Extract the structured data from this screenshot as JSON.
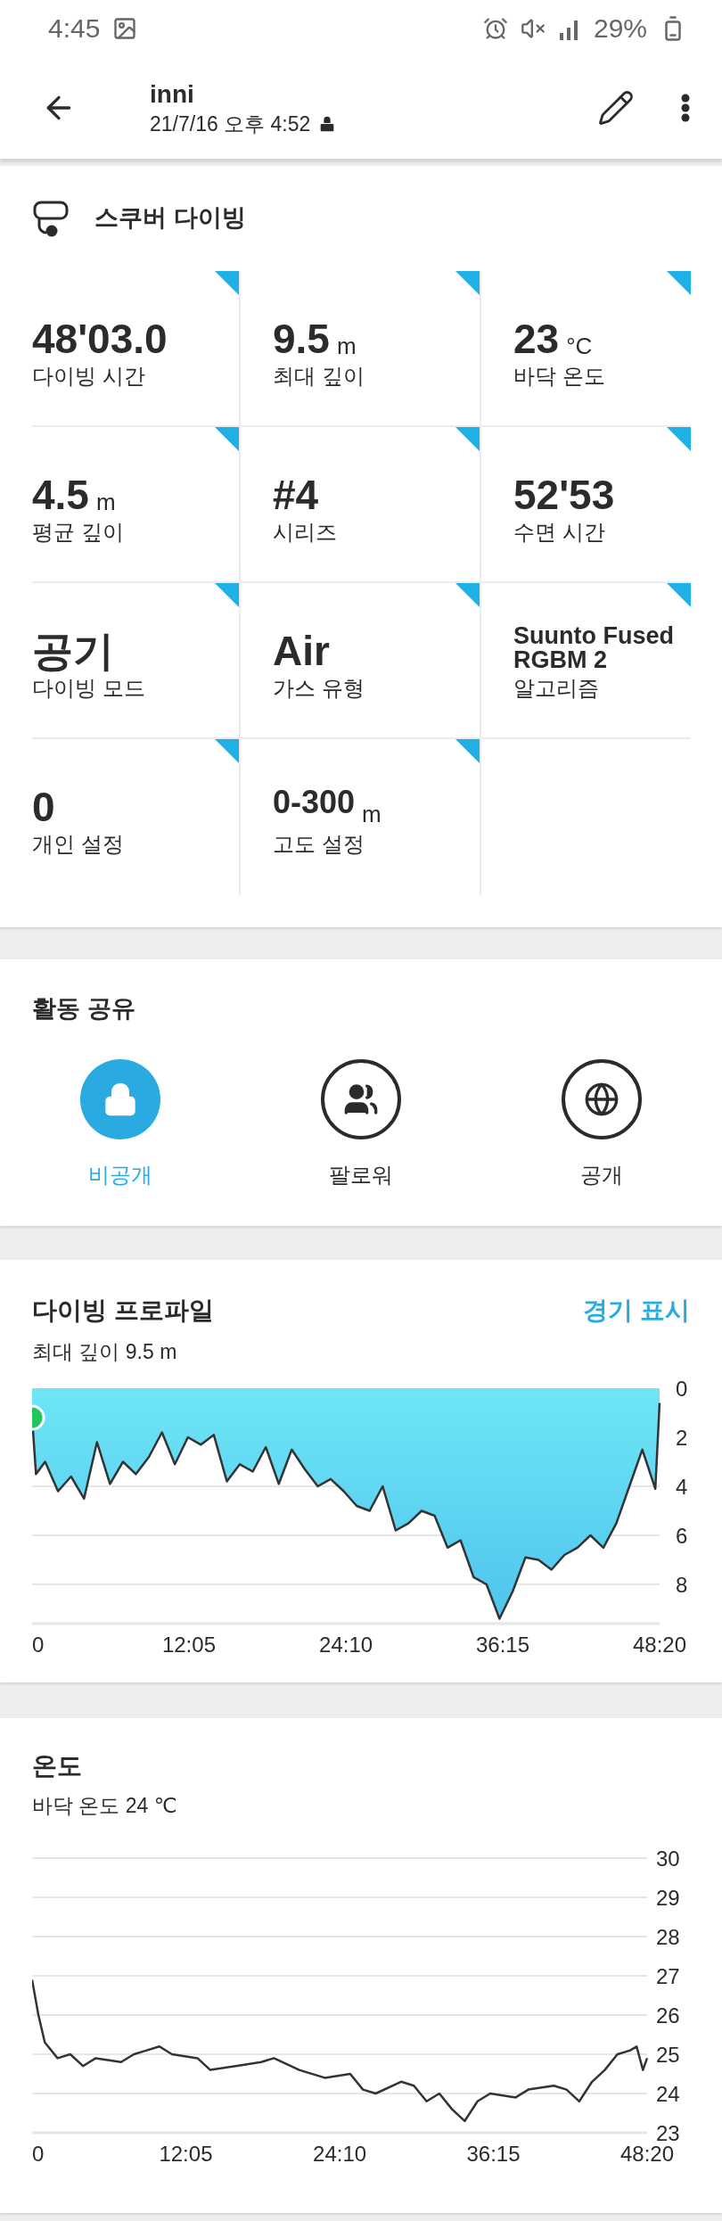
{
  "status_bar": {
    "time": "4:45",
    "battery": "29%"
  },
  "header": {
    "title": "inni",
    "date": "21/7/16 오후 4:52"
  },
  "activity": {
    "title": "스쿠버 다이빙",
    "metrics": [
      {
        "kind": "number",
        "value": "48'03.0",
        "label": "다이빙 시간"
      },
      {
        "kind": "number",
        "value": "9.5",
        "unit": "m",
        "label": "최대 깊이"
      },
      {
        "kind": "number",
        "value": "23",
        "unit": "°C",
        "label": "바닥 온도"
      },
      {
        "kind": "number",
        "value": "4.5",
        "unit": "m",
        "label": "평균 깊이"
      },
      {
        "kind": "number",
        "value": "#4",
        "label": "시리즈"
      },
      {
        "kind": "number",
        "value": "52'53",
        "label": "수면 시간"
      },
      {
        "kind": "number",
        "value": "공기",
        "label": "다이빙 모드"
      },
      {
        "kind": "number",
        "value": "Air",
        "label": "가스 유형"
      },
      {
        "kind": "text",
        "value": "Suunto Fused RGBM 2",
        "label": "알고리즘"
      },
      {
        "kind": "number",
        "value": "0",
        "label": "개인 설정"
      },
      {
        "kind": "small",
        "value": "0-300",
        "unit": "m",
        "label": "고도 설정"
      }
    ]
  },
  "sharing": {
    "title": "활동 공유",
    "options": [
      {
        "kind": "lock",
        "label": "비공개",
        "selected": true
      },
      {
        "kind": "people",
        "label": "팔로워",
        "selected": false
      },
      {
        "kind": "globe",
        "label": "공개",
        "selected": false
      }
    ]
  },
  "profile": {
    "title": "다이빙 프로파일",
    "link": "경기 표시",
    "subtitle": "최대 깊이 9.5 m",
    "chart_data": {
      "type": "area",
      "grid": true,
      "xlim": [
        0,
        48.33
      ],
      "ylim": [
        9.6,
        0
      ],
      "x": [
        0,
        0.3,
        1,
        2,
        3,
        4,
        5,
        6,
        7,
        8,
        9,
        10,
        11,
        12,
        13,
        14,
        15,
        16,
        17,
        18,
        19,
        20,
        21,
        22,
        23,
        24,
        25,
        26,
        27,
        28,
        29,
        30,
        31,
        32,
        33,
        34,
        35,
        36,
        37,
        38,
        39,
        40,
        41,
        42,
        43,
        44,
        45,
        46,
        47,
        48,
        48.33
      ],
      "series": [
        {
          "color": "#333333",
          "values": [
            1.2,
            3.5,
            3.0,
            4.2,
            3.6,
            4.5,
            2.2,
            3.9,
            3.0,
            3.5,
            2.8,
            1.8,
            3.1,
            2.0,
            2.3,
            1.9,
            3.8,
            3.1,
            3.4,
            2.4,
            3.9,
            2.5,
            3.3,
            4.0,
            3.7,
            4.2,
            4.8,
            5.0,
            4.0,
            5.8,
            5.5,
            5.0,
            5.2,
            6.5,
            6.2,
            7.7,
            8.0,
            9.4,
            8.3,
            6.9,
            7.0,
            7.4,
            6.8,
            6.5,
            6.0,
            6.5,
            5.5,
            4.0,
            2.5,
            4.1,
            0.6
          ]
        }
      ],
      "yticks": [
        0,
        2,
        4,
        6,
        8
      ],
      "xticks": [
        {
          "value": 0,
          "label": "0"
        },
        {
          "value": 12.08,
          "label": "12:05"
        },
        {
          "value": 24.17,
          "label": "24:10"
        },
        {
          "value": 36.25,
          "label": "36:15"
        },
        {
          "value": 48.33,
          "label": "48:20"
        }
      ]
    }
  },
  "temperature": {
    "title": "온도",
    "subtitle": "바닥 온도 24 ℃",
    "chart_data": {
      "type": "line",
      "grid": true,
      "xlim": [
        0,
        48.33
      ],
      "ylim": [
        23,
        30
      ],
      "x": [
        0,
        0.5,
        1,
        2,
        3,
        4,
        5,
        7,
        8,
        9,
        10,
        11,
        13,
        14,
        16,
        18,
        19,
        21,
        23,
        25,
        26,
        27,
        29,
        30,
        31,
        32,
        33,
        34,
        35,
        36,
        38,
        39,
        41,
        42,
        43,
        44,
        45,
        46,
        47,
        47.5,
        48,
        48.33
      ],
      "series": [
        {
          "color": "#333333",
          "values": [
            26.9,
            26.0,
            25.3,
            24.9,
            25.0,
            24.7,
            24.9,
            24.8,
            25.0,
            25.1,
            25.2,
            25.0,
            24.9,
            24.6,
            24.7,
            24.8,
            24.9,
            24.6,
            24.4,
            24.5,
            24.1,
            24.0,
            24.3,
            24.2,
            23.8,
            24.0,
            23.6,
            23.3,
            23.8,
            24.0,
            23.9,
            24.1,
            24.2,
            24.1,
            23.8,
            24.3,
            24.6,
            25.0,
            25.1,
            25.2,
            24.6,
            24.9
          ]
        }
      ],
      "yticks": [
        23,
        24,
        25,
        26,
        27,
        28,
        29,
        30
      ],
      "xticks": [
        {
          "value": 0,
          "label": "0"
        },
        {
          "value": 12.08,
          "label": "12:05"
        },
        {
          "value": 24.17,
          "label": "24:10"
        },
        {
          "value": 36.25,
          "label": "36:15"
        },
        {
          "value": 48.33,
          "label": "48:20"
        }
      ]
    }
  }
}
